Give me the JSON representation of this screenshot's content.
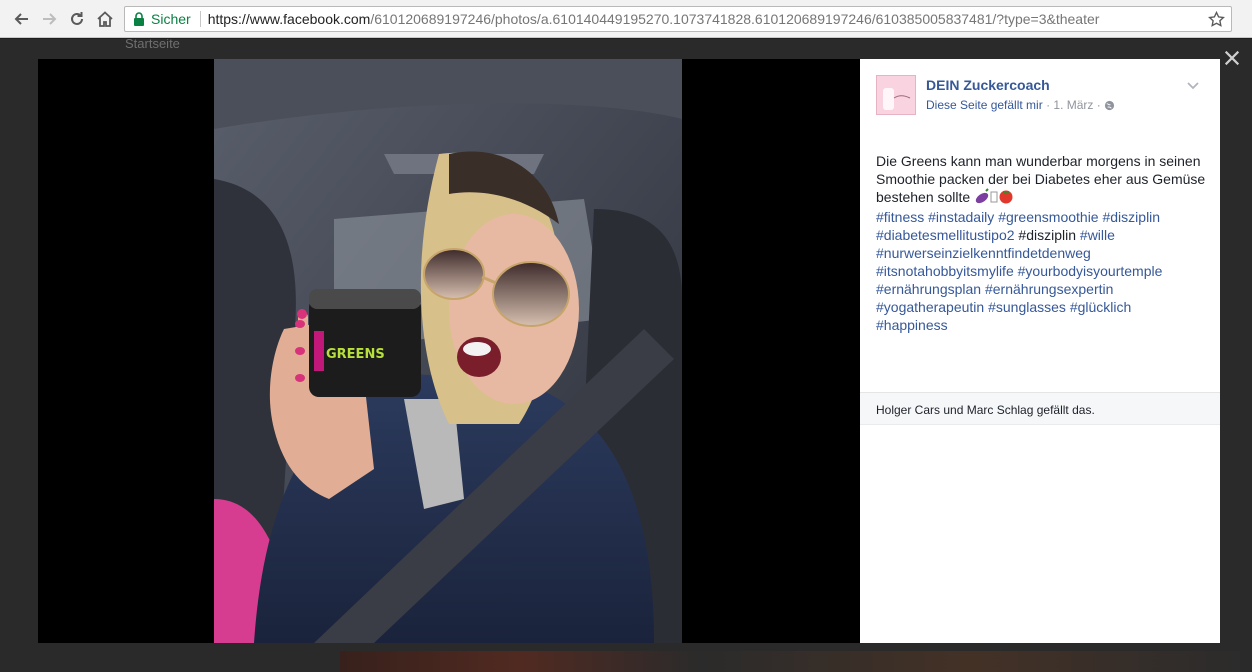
{
  "browser": {
    "secure_label": "Sicher",
    "url_host": "https://www.facebook.com",
    "url_path": "/610120689197246/photos/a.610140449195270.1073741828.610120689197246/610385005837481/?type=3&theater",
    "icons": [
      "back-icon",
      "forward-icon",
      "reload-icon",
      "home-icon",
      "lock-icon",
      "bookmark-star-icon"
    ]
  },
  "background_page": {
    "home_label": "Startseite"
  },
  "post": {
    "page_name": "DEIN Zuckercoach",
    "like_page_label": "Diese Seite gefällt mir",
    "date": "1. März",
    "separator": "·",
    "audience_icon": "globe-icon",
    "text_intro": "Die Greens kann man wunderbar morgens in seinen Smoothie packen der bei Diabetes eher aus Gemüse bestehen sollte",
    "emojis": [
      "eggplant-emoji",
      "unknown-glyph",
      "tomato-emoji"
    ],
    "hashtags_line1": [
      "#fitness",
      "#instadaily",
      "#greensmoothie",
      "#disziplin"
    ],
    "hashtag_diabetes": "#diabetesmellitustipo2",
    "plain_word": "#disziplin",
    "hashtag_wille": "#wille",
    "hashtags_rest": [
      "#nurwerseinzielkenntfindetdenweg",
      "#itsnotahobbyitsmylife",
      "#yourbodyisyourtemple",
      "#ernährungsplan",
      "#ernährungsexpertin",
      "#yogatherapeutin",
      "#sunglasses",
      "#glücklich",
      "#happiness"
    ],
    "likes_text": "Holger Cars und Marc Schlag gefällt das."
  },
  "photo": {
    "jar_label": "GREENS"
  },
  "colors": {
    "link": "#365899",
    "secure": "#0b8043",
    "theater_bg": "#000000",
    "panel_bg": "#ffffff"
  }
}
